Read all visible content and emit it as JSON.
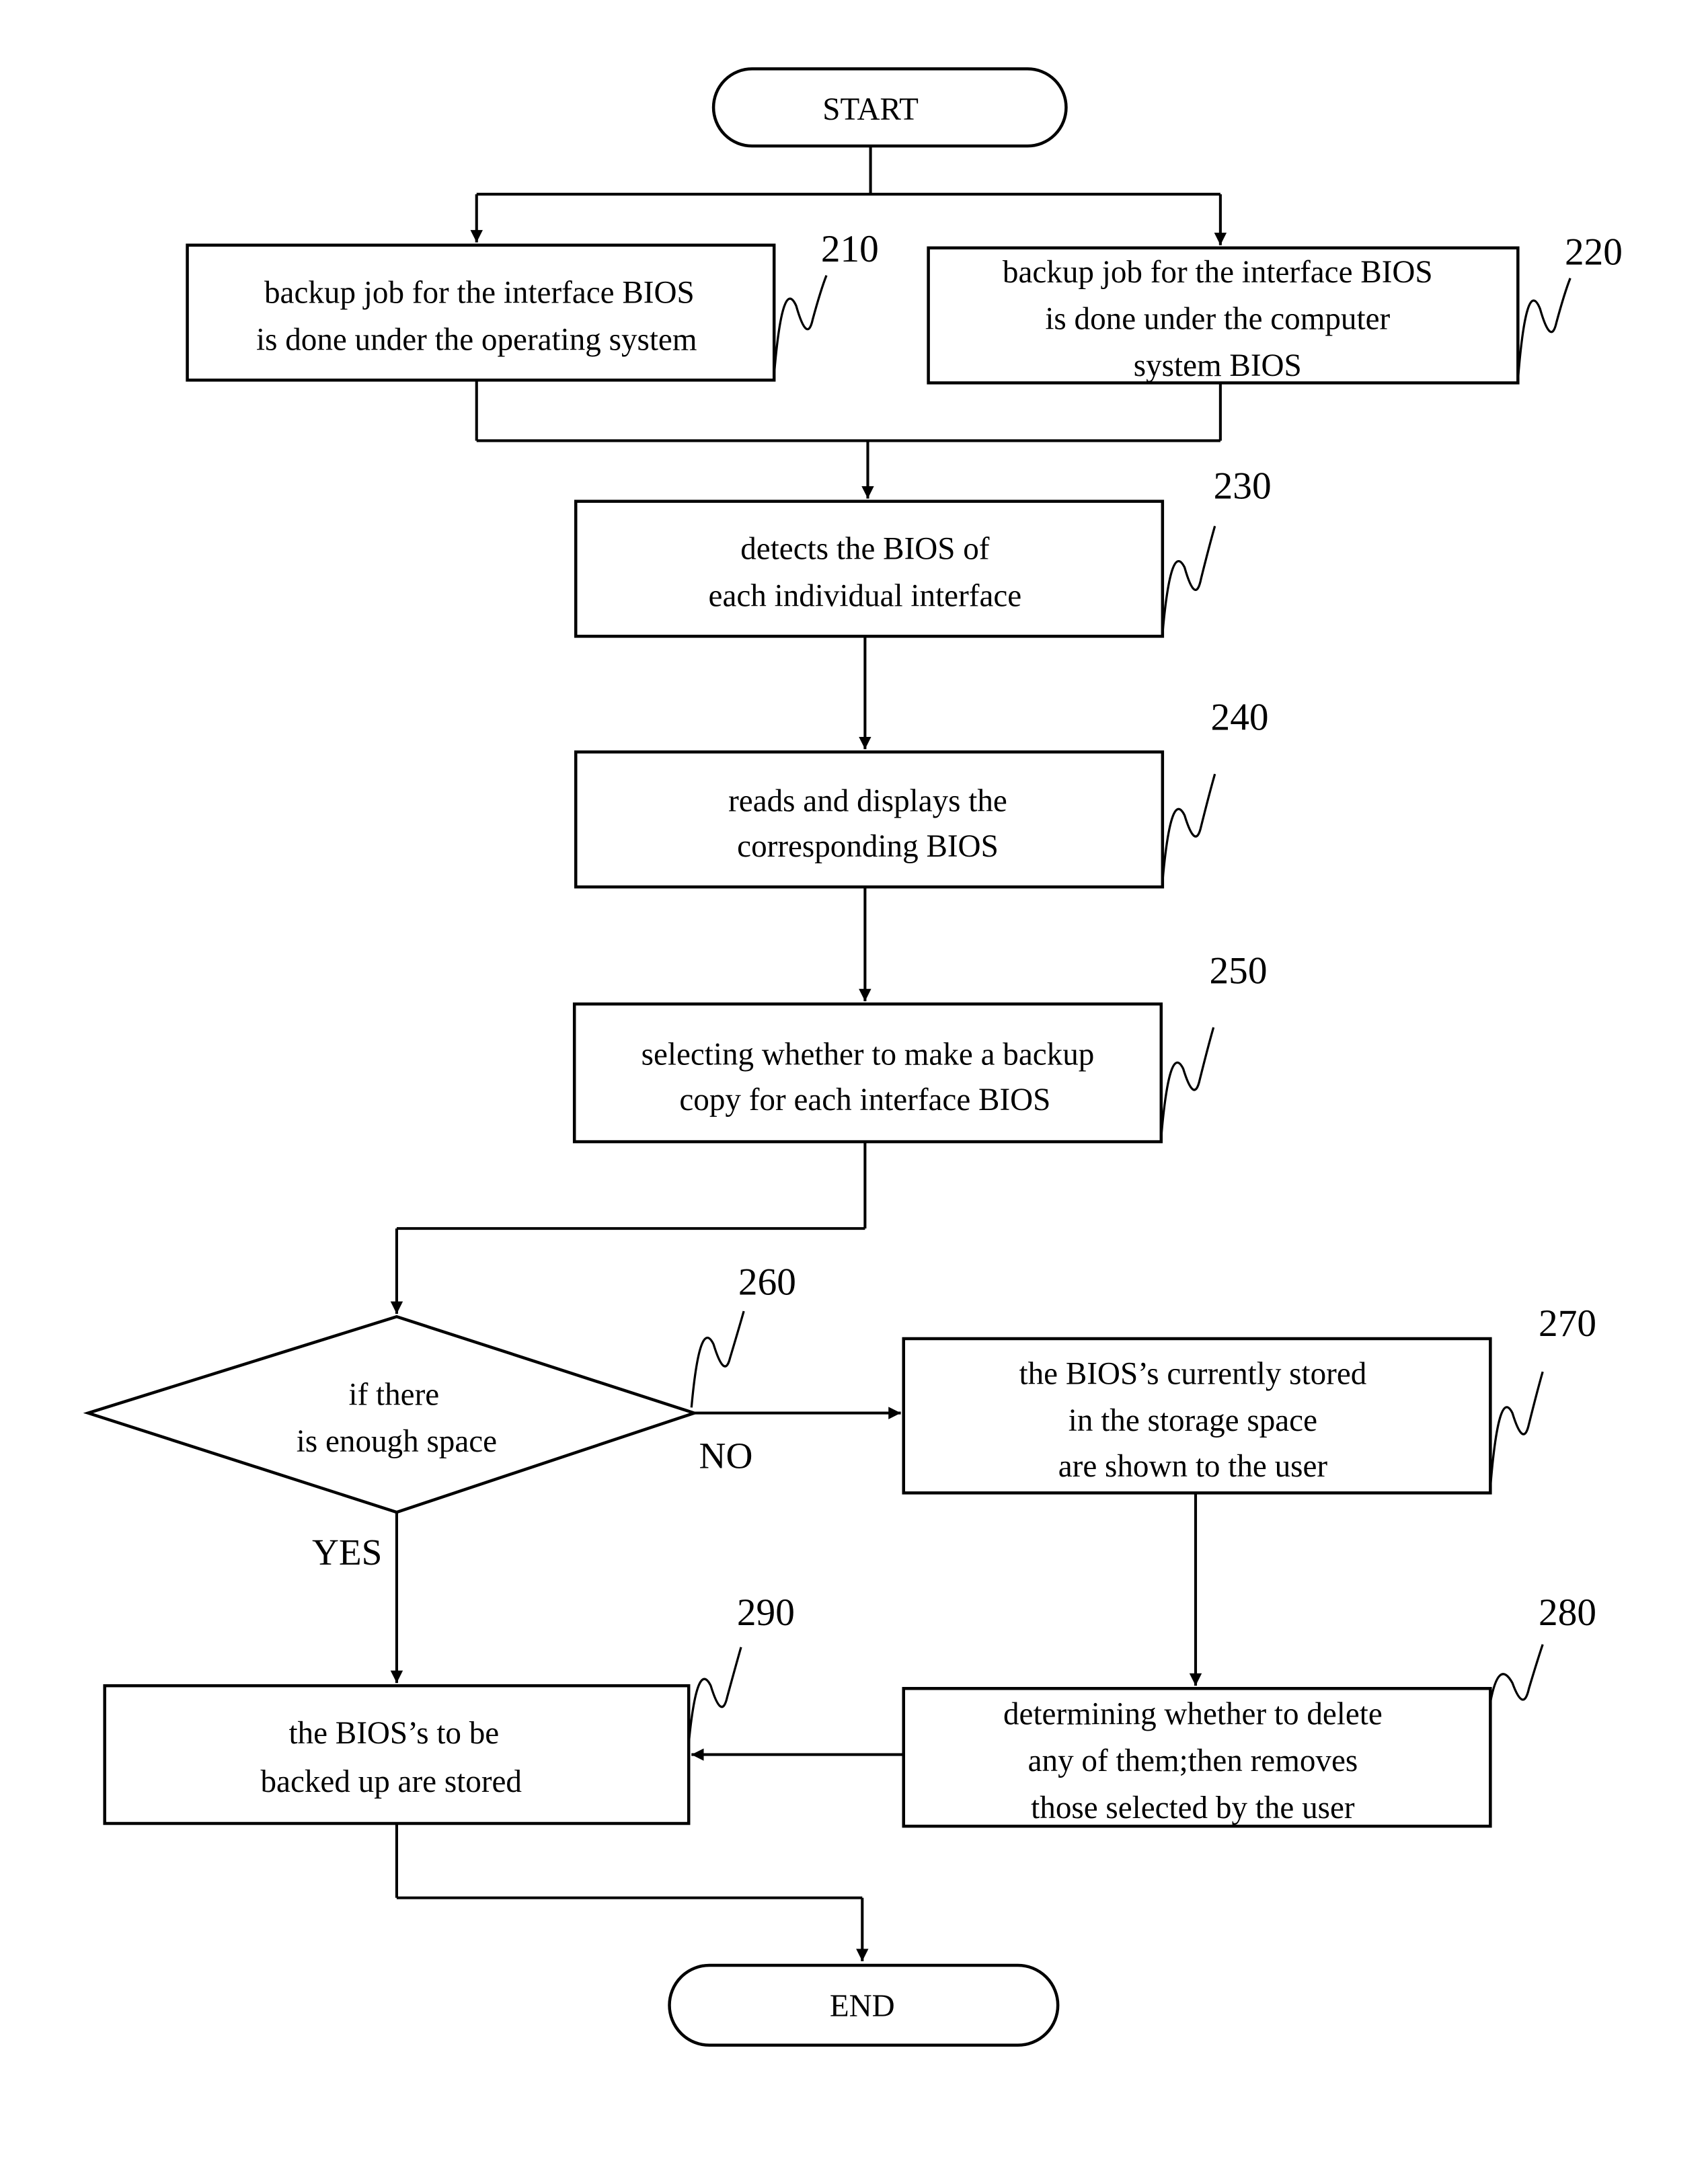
{
  "diagram": {
    "type": "flowchart",
    "start": "START",
    "end": "END",
    "steps": [
      {
        "ref": "210",
        "lines": [
          "backup job for the interface BIOS",
          "is done under the operating system"
        ]
      },
      {
        "ref": "220",
        "lines": [
          "backup job for the interface BIOS",
          "is done under the computer",
          "system BIOS"
        ]
      },
      {
        "ref": "230",
        "lines": [
          "detects the BIOS of",
          "each individual interface"
        ]
      },
      {
        "ref": "240",
        "lines": [
          "reads and displays the",
          "corresponding BIOS"
        ]
      },
      {
        "ref": "250",
        "lines": [
          "selecting whether to make a backup",
          "copy for each interface BIOS"
        ]
      },
      {
        "ref": "260",
        "lines": [
          "if there",
          "is enough space"
        ]
      },
      {
        "ref": "270",
        "lines": [
          "the BIOS’s currently stored",
          "in the storage space",
          "are shown to the user"
        ]
      },
      {
        "ref": "280",
        "lines": [
          "determining whether to delete",
          "any of them;then removes",
          "those selected by the user"
        ]
      },
      {
        "ref": "290",
        "lines": [
          "the BIOS’s to be",
          "backed up are stored"
        ]
      }
    ],
    "branch_labels": {
      "no": "NO",
      "yes": "YES"
    }
  }
}
